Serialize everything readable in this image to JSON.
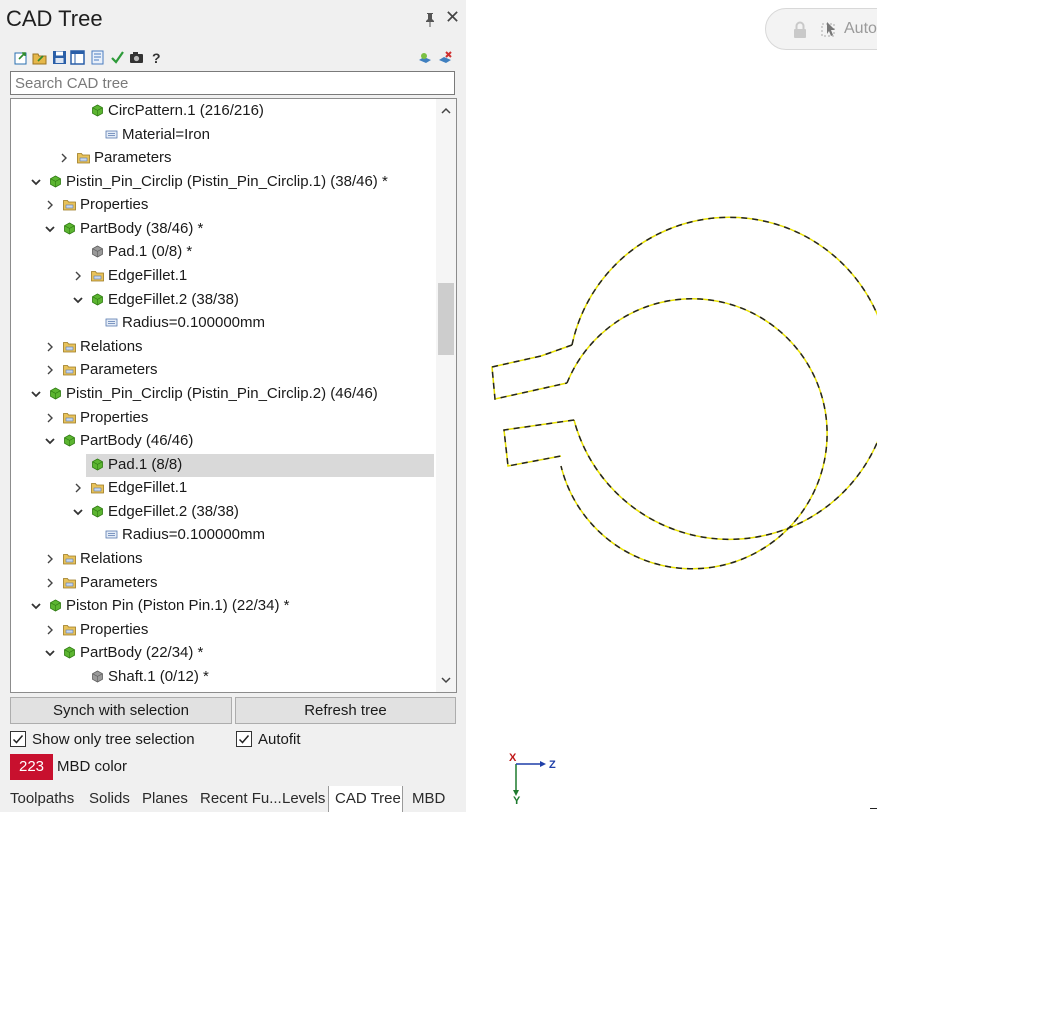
{
  "panel": {
    "title": "CAD Tree",
    "pin_icon": "pin-icon",
    "close_icon": "close-icon",
    "toolbar_icons": [
      "export-icon",
      "import-icon",
      "save-icon",
      "layout-icon",
      "report-icon",
      "checkmark-icon",
      "camera-icon",
      "help-icon",
      "find-icon",
      "settings-icon"
    ],
    "search_placeholder": "Search CAD tree"
  },
  "tree": {
    "nodes": [
      {
        "label": "CircPattern.1 (216/216)",
        "expander": "none",
        "icon": "green-solid-icon"
      },
      {
        "label": "Material=Iron",
        "expander": "none",
        "icon": "parameter-icon"
      },
      {
        "label": "Parameters",
        "expander": "collapsed",
        "icon": "folder-icon"
      },
      {
        "label": "Pistin_Pin_Circlip (Pistin_Pin_Circlip.1) (38/46) *",
        "expander": "expanded",
        "icon": "green-solid-icon"
      },
      {
        "label": "Properties",
        "expander": "collapsed",
        "icon": "folder-icon"
      },
      {
        "label": "PartBody (38/46) *",
        "expander": "expanded",
        "icon": "green-solid-icon"
      },
      {
        "label": "Pad.1 (0/8) *",
        "expander": "none",
        "icon": "gray-solid-icon"
      },
      {
        "label": "EdgeFillet.1",
        "expander": "collapsed",
        "icon": "folder-icon"
      },
      {
        "label": "EdgeFillet.2 (38/38)",
        "expander": "expanded",
        "icon": "green-solid-icon"
      },
      {
        "label": "Radius=0.100000mm",
        "expander": "none",
        "icon": "parameter-icon"
      },
      {
        "label": "Relations",
        "expander": "collapsed",
        "icon": "folder-icon"
      },
      {
        "label": "Parameters",
        "expander": "collapsed",
        "icon": "folder-icon"
      },
      {
        "label": "Pistin_Pin_Circlip (Pistin_Pin_Circlip.2) (46/46)",
        "expander": "expanded",
        "icon": "green-solid-icon"
      },
      {
        "label": "Properties",
        "expander": "collapsed",
        "icon": "folder-icon"
      },
      {
        "label": "PartBody (46/46)",
        "expander": "expanded",
        "icon": "green-solid-icon"
      },
      {
        "label": "Pad.1 (8/8)",
        "expander": "none",
        "icon": "green-solid-icon",
        "selected": true
      },
      {
        "label": "EdgeFillet.1",
        "expander": "collapsed",
        "icon": "folder-icon"
      },
      {
        "label": "EdgeFillet.2 (38/38)",
        "expander": "expanded",
        "icon": "green-solid-icon"
      },
      {
        "label": "Radius=0.100000mm",
        "expander": "none",
        "icon": "parameter-icon"
      },
      {
        "label": "Relations",
        "expander": "collapsed",
        "icon": "folder-icon"
      },
      {
        "label": "Parameters",
        "expander": "collapsed",
        "icon": "folder-icon"
      },
      {
        "label": "Piston Pin (Piston Pin.1) (22/34) *",
        "expander": "expanded",
        "icon": "green-solid-icon"
      },
      {
        "label": "Properties",
        "expander": "collapsed",
        "icon": "folder-icon"
      },
      {
        "label": "PartBody (22/34) *",
        "expander": "expanded",
        "icon": "green-solid-icon"
      },
      {
        "label": "Shaft.1 (0/12) *",
        "expander": "none",
        "icon": "gray-solid-icon"
      }
    ]
  },
  "buttons": {
    "synch": "Synch with selection",
    "refresh": "Refresh tree"
  },
  "options": {
    "show_only_tree_selection": {
      "label": "Show only tree selection",
      "checked": true
    },
    "autofit": {
      "label": "Autofit",
      "checked": true
    }
  },
  "mbd": {
    "value": "223",
    "label": "MBD color",
    "color": "#c8102e"
  },
  "tabs": [
    "Toolpaths",
    "Solids",
    "Planes",
    "Recent Fu...",
    "Levels",
    "CAD Tree",
    "MBD"
  ],
  "active_tab": "CAD Tree",
  "viewport": {
    "pill_text": "Autoc",
    "axis_labels": {
      "x": "X",
      "y": "Y",
      "z": "Z"
    },
    "outline_color": "#e8e000",
    "dash_color": "#222222"
  }
}
